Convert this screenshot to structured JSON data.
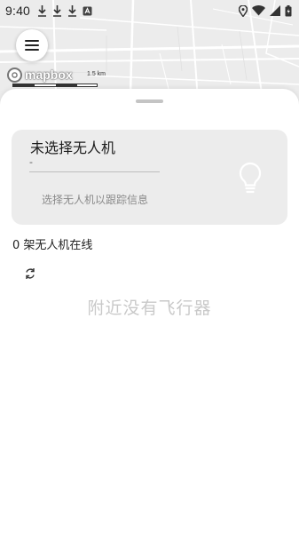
{
  "status_bar": {
    "time": "9:40",
    "notification_icons": [
      "download-icon",
      "download-icon",
      "download-icon",
      "app-notification-icon"
    ],
    "system_icons": [
      "location-icon",
      "wifi-icon",
      "signal-icon",
      "battery-icon"
    ]
  },
  "map": {
    "attribution_logo": "mapbox",
    "scale_label": "1.5 km",
    "menu_icon": "hamburger-menu-icon"
  },
  "drone_card": {
    "title": "未选择无人机",
    "subtitle": "-",
    "hint": "选择无人机以跟踪信息",
    "icon": "lightbulb-icon"
  },
  "online_count_text": "0 架无人机在线",
  "refresh_icon": "refresh-icon",
  "empty_state_text": "附近没有飞行器",
  "colors": {
    "card_bg": "#ececec",
    "empty_text": "#c9c9c9",
    "map_bg": "#ececec"
  }
}
